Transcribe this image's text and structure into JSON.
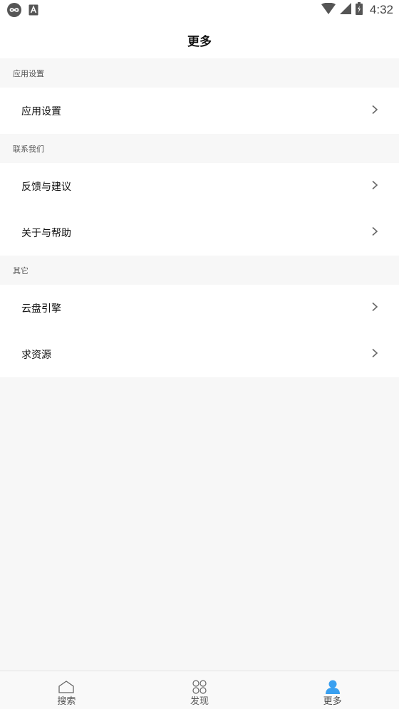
{
  "status_bar": {
    "time": "4:32",
    "icons": [
      "infinity-icon",
      "a-icon",
      "wifi-icon",
      "cell-signal-icon",
      "battery-icon"
    ]
  },
  "header": {
    "title": "更多"
  },
  "sections": [
    {
      "title": "应用设置",
      "items": [
        {
          "label": "应用设置"
        }
      ]
    },
    {
      "title": "联系我们",
      "items": [
        {
          "label": "反馈与建议"
        },
        {
          "label": "关于与帮助"
        }
      ]
    },
    {
      "title": "其它",
      "items": [
        {
          "label": "云盘引擎"
        },
        {
          "label": "求资源"
        }
      ]
    }
  ],
  "bottom_nav": {
    "items": [
      {
        "label": "搜索",
        "icon": "home-icon"
      },
      {
        "label": "发现",
        "icon": "grid-icon"
      },
      {
        "label": "更多",
        "icon": "user-icon",
        "active": true
      }
    ]
  },
  "colors": {
    "accent": "#3aa0f0",
    "background": "#f7f7f7",
    "row_background": "#ffffff"
  }
}
